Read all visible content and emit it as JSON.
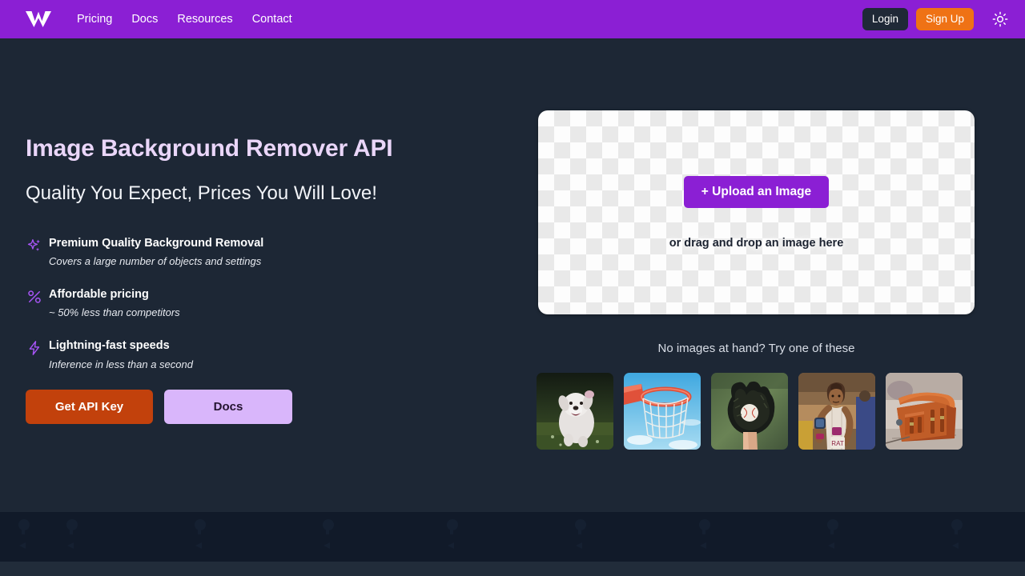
{
  "navbar": {
    "logo_name": "w-logo",
    "links": [
      {
        "label": "Pricing"
      },
      {
        "label": "Docs"
      },
      {
        "label": "Resources"
      },
      {
        "label": "Contact"
      }
    ],
    "login_label": "Login",
    "signup_label": "Sign Up",
    "theme_icon": "sun-icon",
    "colors": {
      "bar": "#8b1fd4",
      "login_bg": "#1f2937",
      "signup_bg": "#ef7215"
    }
  },
  "hero": {
    "headline": "Image Background Remover API",
    "subheadline": "Quality You Expect, Prices You Will Love!",
    "features": [
      {
        "icon": "sparkles-icon",
        "title": "Premium Quality Background Removal",
        "subtitle": "Covers a large number of objects and settings"
      },
      {
        "icon": "percent-icon",
        "title": "Affordable pricing",
        "subtitle": "~ 50% less than competitors"
      },
      {
        "icon": "lightning-bolt-icon",
        "title": "Lightning-fast speeds",
        "subtitle": "Inference in less than a second"
      }
    ],
    "cta": {
      "primary_label": "Get API Key",
      "secondary_label": "Docs",
      "primary_color": "#c2410c",
      "secondary_color": "#d9b6fb"
    }
  },
  "upload": {
    "button_label": "+ Upload an Image",
    "button_color": "#8b1fd4",
    "drop_hint": "or drag and drop an image here",
    "background": "transparency-checkerboard"
  },
  "samples": {
    "caption": "No images at hand? Try one of these",
    "thumbnails": [
      {
        "name": "sample-dog",
        "alt": "white fluffy dog running in grass"
      },
      {
        "name": "sample-basketball-hoop",
        "alt": "basketball hoop against blue sky"
      },
      {
        "name": "sample-baseball-glove",
        "alt": "baseball glove holding a ball"
      },
      {
        "name": "sample-runner",
        "alt": "female runner in a race"
      },
      {
        "name": "sample-leather-bag",
        "alt": "brown leather satchel bag"
      }
    ]
  },
  "theme": {
    "page_background": "#1d2735",
    "accent_purple": "#8b1fd4",
    "icon_purple": "#a855f7"
  }
}
